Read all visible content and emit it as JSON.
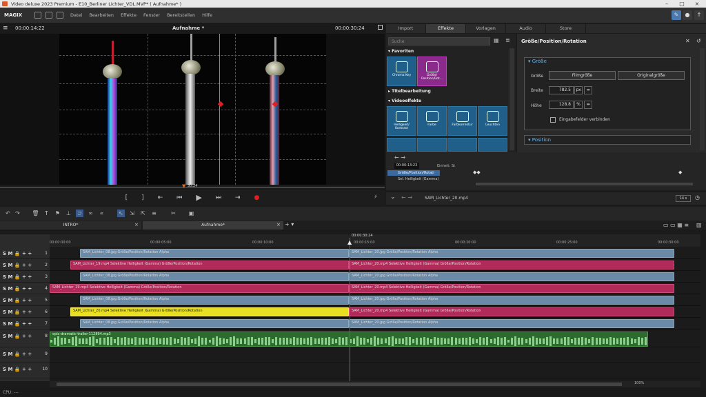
{
  "window": {
    "title": "Video deluxe 2023 Premium - E10_Berliner Lichter_VDL.MVP* ( Aufnahme* )"
  },
  "menu": {
    "brand": "MAGIX",
    "items": [
      "Datei",
      "Bearbeiten",
      "Effekte",
      "Fenster",
      "Bereitstellen",
      "Hilfe"
    ]
  },
  "preview": {
    "timecode_left": "00:00:14:22",
    "title": "Aufnahme *",
    "timecode_right": "00:00:30:24",
    "scrub_label": "30:24"
  },
  "tabs": [
    "Import",
    "Effekte",
    "Vorlagen",
    "Audio",
    "Store"
  ],
  "active_tab": "Effekte",
  "library": {
    "search_placeholder": "Suche",
    "sections": {
      "favorites": "Favoriten",
      "title": "Titelbearbeitung",
      "video": "Videoeffekte"
    },
    "favorites": [
      {
        "label": "Chroma Key"
      },
      {
        "label": "Größe/ Position/Rot..."
      }
    ],
    "effects": [
      {
        "label": "Helligkeit/ Kontrast"
      },
      {
        "label": "Farbe"
      },
      {
        "label": "Farbkorrektur"
      },
      {
        "label": "Leuchten"
      }
    ]
  },
  "properties": {
    "title": "Größe/Position/Rotation",
    "group_size": "Größe",
    "size_label": "Größe",
    "btn_film": "Filmgröße",
    "btn_original": "Originalgröße",
    "width_label": "Breite",
    "width_value": "782.5",
    "width_unit": "px",
    "height_label": "Höhe",
    "height_value": "128.8",
    "height_unit": "%",
    "link_label": "Eingabefelder verbinden",
    "group_position": "Position"
  },
  "keyframes": {
    "timecode": "00:00:13:23",
    "unit_label": "Einheit:",
    "unit_value": "St",
    "row1": "Größe/Position/Rotati",
    "row2": "Sel. Helligkeit (Gamma)",
    "clip_name": "SAM_Lichter_20.mp4",
    "zoom": "14 s"
  },
  "arrangement_tabs": [
    "INTRO*",
    "Aufnahme*"
  ],
  "ruler": {
    "playhead": "00:00:30:24",
    "ticks": [
      "00:00:00:00",
      "00:00:05:00",
      "00:00:10:00",
      "00:00:15:00",
      "00:00:20:00",
      "00:00:25:00",
      "00:00:30:00"
    ]
  },
  "tracks": [
    {
      "num": "1",
      "clips": [
        {
          "t": "blue",
          "l": 44,
          "w": 390,
          "text": "SAM_Lichter_08.jpg  Größe/Position/Rotation  Alpha"
        },
        {
          "t": "blue",
          "l": 434,
          "w": 472,
          "text": "SAM_Lichter_20.jpg  Größe/Position/Rotation  Alpha"
        }
      ]
    },
    {
      "num": "2",
      "clips": [
        {
          "t": "mag",
          "l": 30,
          "w": 404,
          "text": "SAM_Lichter_19.mp4  Selektive Helligkeit (Gamma)  Größe/Position/Rotation"
        },
        {
          "t": "mag",
          "l": 434,
          "w": 472,
          "text": "SAM_Lichter_20.mp4  Selektive Helligkeit (Gamma)  Größe/Position/Rotation"
        }
      ]
    },
    {
      "num": "3",
      "clips": [
        {
          "t": "blue",
          "l": 44,
          "w": 390,
          "text": "SAM_Lichter_08.jpg  Größe/Position/Rotation  Alpha"
        },
        {
          "t": "blue",
          "l": 434,
          "w": 472,
          "text": "SAM_Lichter_20.jpg  Größe/Position/Rotation  Alpha"
        }
      ]
    },
    {
      "num": "4",
      "clips": [
        {
          "t": "mag",
          "l": 0,
          "w": 434,
          "text": "SAM_Lichter_19.mp4  Selektive Helligkeit (Gamma)  Größe/Position/Rotation"
        },
        {
          "t": "mag",
          "l": 434,
          "w": 472,
          "text": "SAM_Lichter_20.mp4  Selektive Helligkeit (Gamma)  Größe/Position/Rotation"
        }
      ]
    },
    {
      "num": "5",
      "clips": [
        {
          "t": "blue",
          "l": 44,
          "w": 390,
          "text": "SAM_Lichter_08.jpg  Größe/Position/Rotation  Alpha"
        },
        {
          "t": "blue",
          "l": 434,
          "w": 472,
          "text": "SAM_Lichter_20.jpg  Größe/Position/Rotation  Alpha"
        }
      ]
    },
    {
      "num": "6",
      "clips": [
        {
          "t": "yel",
          "l": 30,
          "w": 404,
          "text": "SAM_Lichter_20.mp4  Selektive Helligkeit (Gamma)  Größe/Position/Rotation"
        },
        {
          "t": "mag",
          "l": 434,
          "w": 472,
          "text": "SAM_Lichter_20.mp4  Selektive Helligkeit (Gamma)  Größe/Position/Rotation"
        }
      ]
    },
    {
      "num": "7",
      "clips": [
        {
          "t": "blue",
          "l": 44,
          "w": 390,
          "text": "SAM_Lichter_08.jpg  Größe/Position/Rotation  Alpha"
        },
        {
          "t": "blue",
          "l": 434,
          "w": 472,
          "text": "SAM_Lichter_20.jpg  Größe/Position/Rotation  Alpha"
        }
      ]
    }
  ],
  "audio_track": {
    "num": "8",
    "text": "epic-dramatic-trailer-112894.mp3"
  },
  "empty_tracks": [
    "9",
    "10"
  ],
  "zoom_percent": "100%",
  "status": "CPU: ---"
}
